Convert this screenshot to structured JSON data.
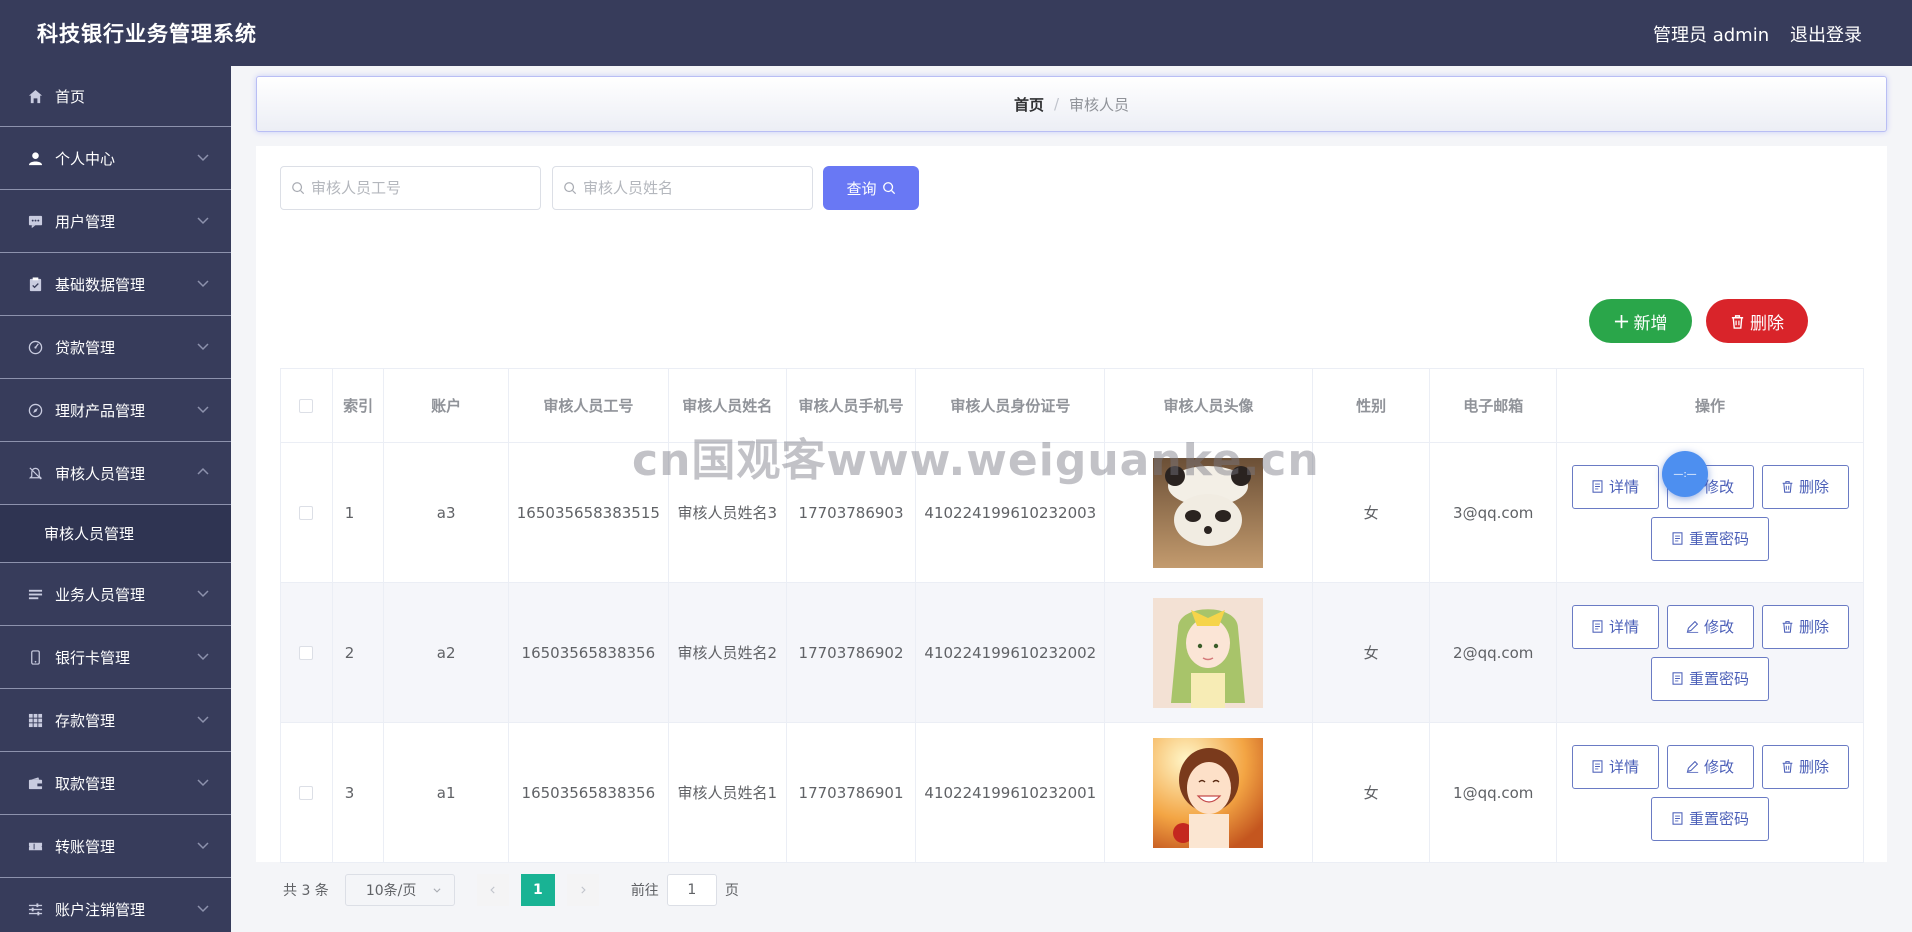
{
  "header": {
    "title": "科技银行业务管理系统",
    "user_label": "管理员 admin",
    "logout_label": "退出登录"
  },
  "sidebar": {
    "items": [
      {
        "label": "首页",
        "icon": "home-icon"
      },
      {
        "label": "个人中心",
        "icon": "user-icon"
      },
      {
        "label": "用户管理",
        "icon": "chat-icon"
      },
      {
        "label": "基础数据管理",
        "icon": "clipboard-icon"
      },
      {
        "label": "贷款管理",
        "icon": "gauge-icon"
      },
      {
        "label": "理财产品管理",
        "icon": "compass-icon"
      },
      {
        "label": "审核人员管理",
        "icon": "bell-off-icon",
        "expanded": true
      },
      {
        "label": "业务人员管理",
        "icon": "list-icon"
      },
      {
        "label": "银行卡管理",
        "icon": "phone-icon"
      },
      {
        "label": "存款管理",
        "icon": "grid-icon"
      },
      {
        "label": "取款管理",
        "icon": "wallet-icon"
      },
      {
        "label": "转账管理",
        "icon": "ticket-icon"
      },
      {
        "label": "账户注销管理",
        "icon": "sliders-icon"
      }
    ],
    "submenu_label": "审核人员管理"
  },
  "breadcrumb": {
    "home": "首页",
    "separator": "/",
    "current": "审核人员"
  },
  "search": {
    "id_placeholder": "审核人员工号",
    "name_placeholder": "审核人员姓名",
    "query_label": "查询"
  },
  "actions": {
    "add_label": "新增",
    "delete_label": "删除"
  },
  "table": {
    "headers": [
      "索引",
      "账户",
      "审核人员工号",
      "审核人员姓名",
      "审核人员手机号",
      "审核人员身份证号",
      "审核人员头像",
      "性别",
      "电子邮箱",
      "操作"
    ],
    "rows": [
      {
        "index": "1",
        "account": "a3",
        "staff_id": "165035658383515",
        "name": "审核人员姓名3",
        "phone": "17703786903",
        "id_card": "410224199610232003",
        "avatar": "panda-photo",
        "gender": "女",
        "email": "3@qq.com"
      },
      {
        "index": "2",
        "account": "a2",
        "staff_id": "16503565838356",
        "name": "审核人员姓名2",
        "phone": "17703786902",
        "id_card": "410224199610232002",
        "avatar": "anime-girl-photo",
        "gender": "女",
        "email": "2@qq.com"
      },
      {
        "index": "3",
        "account": "a1",
        "staff_id": "16503565838356",
        "name": "审核人员姓名1",
        "phone": "17703786901",
        "id_card": "410224199610232001",
        "avatar": "smiling-woman-photo",
        "gender": "女",
        "email": "1@qq.com"
      }
    ],
    "op_labels": {
      "detail": "详情",
      "edit": "修改",
      "delete": "删除",
      "reset": "重置密码"
    }
  },
  "pager": {
    "total": "共 3 条",
    "page_size": "10条/页",
    "current_page": "1",
    "goto_label": "前往",
    "goto_value": "1",
    "page_suffix": "页"
  },
  "watermark": "cn国观客www.weiguanke.cn",
  "float_ball_text": "—:—",
  "colors": {
    "header_bg": "#373c5b",
    "query_button": "#6978f4",
    "add_button": "#2aa64a",
    "delete_button": "#d9242a",
    "pager_active": "#19b394"
  }
}
